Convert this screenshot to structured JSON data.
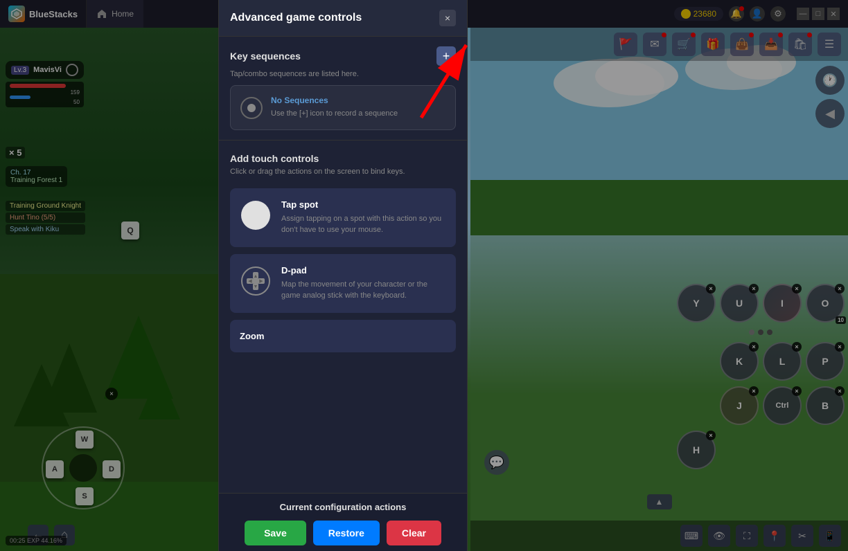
{
  "app": {
    "title": "BlueStacks",
    "tab_home": "Home",
    "coins": "23680"
  },
  "agc": {
    "title": "Advanced game controls",
    "close_label": "×",
    "key_sequences_title": "Key sequences",
    "key_sequences_subtitle": "Tap/combo sequences are listed here.",
    "add_btn_label": "+",
    "no_sequences_title": "No Sequences",
    "no_sequences_desc": "Use the [+] icon to record a sequence",
    "add_touch_title": "Add touch controls",
    "add_touch_desc": "Click or drag the actions on the screen to bind keys.",
    "tap_spot_title": "Tap spot",
    "tap_spot_desc": "Assign tapping on a spot with this action so you don't have to use your mouse.",
    "dpad_title": "D-pad",
    "dpad_desc": "Map the movement of your character or the game analog stick with the keyboard.",
    "zoom_title": "Zoom",
    "config_title": "Current configuration actions",
    "save_label": "Save",
    "restore_label": "Restore",
    "clear_label": "Clear"
  },
  "player": {
    "level": "Lv.3",
    "name": "MavisVi",
    "hp": "159",
    "mp": "50",
    "location": "Ch. 17\nTraining Forest 1",
    "exp": "00:25 EXP 44.16%",
    "x_count": "× 5"
  },
  "dpad_keys": {
    "up": "W",
    "left": "A",
    "right": "D",
    "down": "S"
  },
  "skills": {
    "row1": [
      "Y",
      "U",
      "I",
      "O"
    ],
    "row2": [
      "K",
      "L",
      "P"
    ],
    "row3": [
      "J",
      "Ctrl",
      "B"
    ],
    "row4": [
      "H"
    ]
  }
}
